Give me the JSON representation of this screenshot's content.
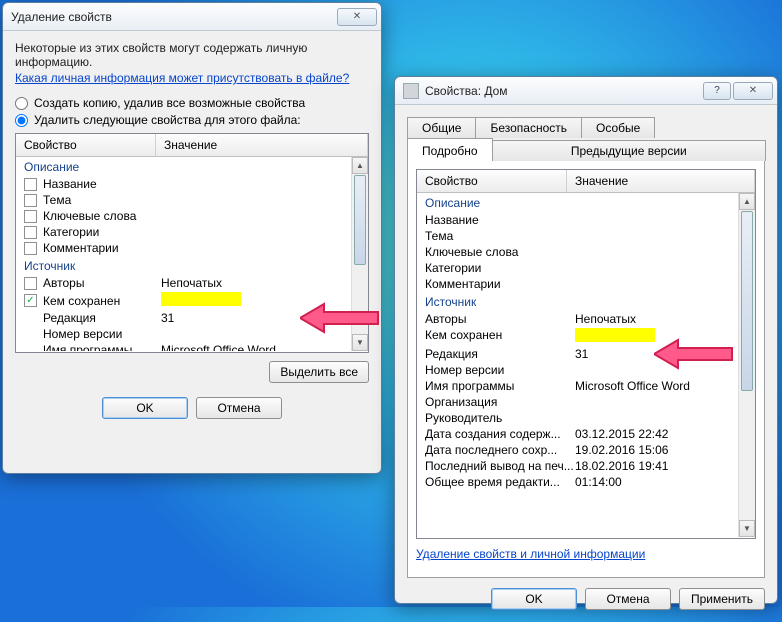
{
  "win1": {
    "title": "Удаление свойств",
    "intro1": "Некоторые из этих свойств могут содержать личную информацию.",
    "link": "Какая личная информация может присутствовать в файле?",
    "radio1": "Создать копию, удалив все возможные свойства",
    "radio2": "Удалить следующие свойства для этого файла:",
    "col_prop": "Свойство",
    "col_val": "Значение",
    "group_desc": "Описание",
    "group_src": "Источник",
    "rows_desc": [
      {
        "label": "Название",
        "value": ""
      },
      {
        "label": "Тема",
        "value": ""
      },
      {
        "label": "Ключевые слова",
        "value": ""
      },
      {
        "label": "Категории",
        "value": ""
      },
      {
        "label": "Комментарии",
        "value": ""
      }
    ],
    "rows_src": [
      {
        "label": "Авторы",
        "value": "Непочатых",
        "checked": false
      },
      {
        "label": "Кем сохранен",
        "value": "",
        "checked": true,
        "hl": true
      },
      {
        "label": "Редакция",
        "value": "31",
        "nocheck": true
      },
      {
        "label": "Номер версии",
        "value": "",
        "nocheck": true
      },
      {
        "label": "Имя программы",
        "value": "Microsoft Office Word",
        "nocheck": true
      }
    ],
    "select_all": "Выделить все",
    "ok": "OK",
    "cancel": "Отмена"
  },
  "win2": {
    "title": "Свойства: Дом",
    "tabs_row1": [
      "Общие",
      "Безопасность",
      "Особые"
    ],
    "tabs_row2": [
      "Подробно",
      "Предыдущие версии"
    ],
    "active_tab": "Подробно",
    "col_prop": "Свойство",
    "col_val": "Значение",
    "group_desc": "Описание",
    "group_src": "Источник",
    "rows_desc": [
      {
        "label": "Название",
        "value": ""
      },
      {
        "label": "Тема",
        "value": ""
      },
      {
        "label": "Ключевые слова",
        "value": ""
      },
      {
        "label": "Категории",
        "value": ""
      },
      {
        "label": "Комментарии",
        "value": ""
      }
    ],
    "rows_src": [
      {
        "label": "Авторы",
        "value": "Непочатых"
      },
      {
        "label": "Кем сохранен",
        "value": "",
        "hl": true
      },
      {
        "label": "Редакция",
        "value": "31"
      },
      {
        "label": "Номер версии",
        "value": ""
      },
      {
        "label": "Имя программы",
        "value": "Microsoft Office Word"
      },
      {
        "label": "Организация",
        "value": ""
      },
      {
        "label": "Руководитель",
        "value": ""
      },
      {
        "label": "Дата создания содерж...",
        "value": "03.12.2015 22:42"
      },
      {
        "label": "Дата последнего сохр...",
        "value": "19.02.2016 15:06"
      },
      {
        "label": "Последний вывод на печ...",
        "value": "18.02.2016 19:41"
      },
      {
        "label": "Общее время редакти...",
        "value": "01:14:00"
      }
    ],
    "remove_link": "Удаление свойств и личной информации",
    "ok": "OK",
    "cancel": "Отмена",
    "apply": "Применить"
  }
}
